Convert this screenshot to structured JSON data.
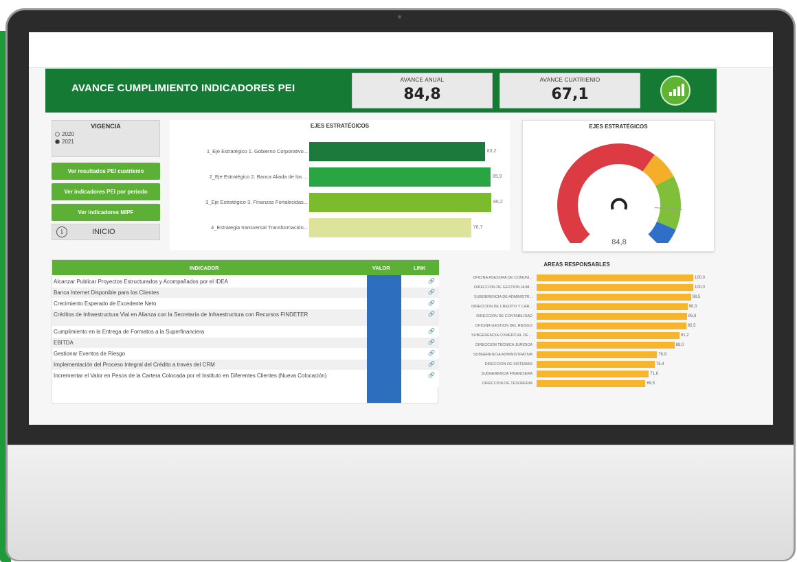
{
  "dashboard": {
    "title": "AVANCE CUMPLIMIENTO INDICADORES PEI",
    "kpi_anual_label": "AVANCE ANUAL",
    "kpi_anual_value": "84,8",
    "kpi_cuatrienio_label": "AVANCE CUATRIENIO",
    "kpi_cuatrienio_value": "67,1",
    "logo_icon": "bar-chart-icon"
  },
  "vigencia": {
    "title": "VIGENCIA",
    "options": [
      "2020",
      "2021"
    ],
    "selected": "2021"
  },
  "nav": {
    "btn1": "Ver resultados PEI cuatrienio",
    "btn2": "Ver indicadores PEI por periodo",
    "btn3": "Ver indicadores MIPF",
    "inicio": "INICIO",
    "info_icon": "i"
  },
  "ejes": {
    "title": "EJES ESTRATÉGICOS",
    "items": [
      {
        "label": "1_Eje Estratégico 1. Gobierno Corporativo...",
        "value": 83.2,
        "display": "83,2",
        "color": "#1d7a3c"
      },
      {
        "label": "2_Eje Estratégico 2. Banca Aliada de los ...",
        "value": 85.9,
        "display": "85,9",
        "color": "#2aa544"
      },
      {
        "label": "3_Eje Estratégico 3. Finanzas Fortalecidas...",
        "value": 86.2,
        "display": "86,2",
        "color": "#7cbb2d"
      },
      {
        "label": "4_Estrategia transversal Transformación...",
        "value": 76.7,
        "display": "76,7",
        "color": "#dde39a"
      }
    ]
  },
  "gauge": {
    "title": "EJES ESTRATÉGICOS",
    "value": 84.8,
    "display": "84,8",
    "bands": [
      {
        "color": "#dd3b44"
      },
      {
        "color": "#f4ae2a"
      },
      {
        "color": "#7fbf3a"
      },
      {
        "color": "#2f6fca"
      }
    ]
  },
  "tabla": {
    "col_indicador": "INDICADOR",
    "col_valor": "VALOR",
    "col_link": "LINK",
    "value_color": "#2d6fbd",
    "rows": [
      {
        "indicador": "Alcanzar Publicar Proyectos Estructurados y Acompañados por el IDEA",
        "link": "🔗"
      },
      {
        "indicador": "Banca Internet Disponible para los Clientes",
        "link": "🔗"
      },
      {
        "indicador": "Crecimiento Esperado de Excedente Neto",
        "link": "🔗"
      },
      {
        "indicador": "Créditos de Infraestructura Vial en Alianza con la Secretaría de Infraestructura con Recursos FINDETER",
        "link": "🔗"
      },
      {
        "indicador": "Cumplimiento en la Entrega de Formatos a la Superfinanciera",
        "link": "🔗"
      },
      {
        "indicador": "EBITDA",
        "link": "🔗"
      },
      {
        "indicador": "Gestionar Eventos de Riesgo",
        "link": "🔗"
      },
      {
        "indicador": "Implementación del Proceso Integral del Crédito a través del CRM",
        "link": "🔗"
      },
      {
        "indicador": "Incrementar el Valor en Pesos de la Cartera Colocada por el Instituto en Diferentes Clientes (Nueva Colocación)",
        "link": "🔗"
      }
    ]
  },
  "areas": {
    "title": "AREAS RESPONSABLES",
    "items": [
      {
        "label": "OFICINA ASESORA DE COMUNI...",
        "value": 100,
        "display": "100,0"
      },
      {
        "label": "DIRECCIÓN DE GESTIÓN HUM...",
        "value": 100,
        "display": "100,0"
      },
      {
        "label": "SUBGERENCIA DE ADMINISTR...",
        "value": 98.5,
        "display": "98,5"
      },
      {
        "label": "DIRECCIÓN DE CRÉDITO Y CAR...",
        "value": 96.3,
        "display": "96,3"
      },
      {
        "label": "DIRECCIÓN DE CONTABILIDAD",
        "value": 95.9,
        "display": "95,9"
      },
      {
        "label": "OFICINA GESTIÓN DEL RIESGO",
        "value": 95.5,
        "display": "95,5"
      },
      {
        "label": "SUBGERENCIA COMERCIAL DE ...",
        "value": 91.2,
        "display": "91,2"
      },
      {
        "label": "DIRECCIÓN TÉCNICA JURÍDICA",
        "value": 88.0,
        "display": "88,0"
      },
      {
        "label": "SUBGERENCIA ADMINISTRATIVA",
        "value": 76.9,
        "display": "76,9"
      },
      {
        "label": "DIRECCIÓN DE SISTEMAS",
        "value": 75.4,
        "display": "75,4"
      },
      {
        "label": "SUBGERENCIA FINANCIERA",
        "value": 71.6,
        "display": "71,6"
      },
      {
        "label": "DIRECCIÓN DE TESORERÍA",
        "value": 69.5,
        "display": "69,5"
      }
    ],
    "bar_color": "#f7b52c"
  }
}
